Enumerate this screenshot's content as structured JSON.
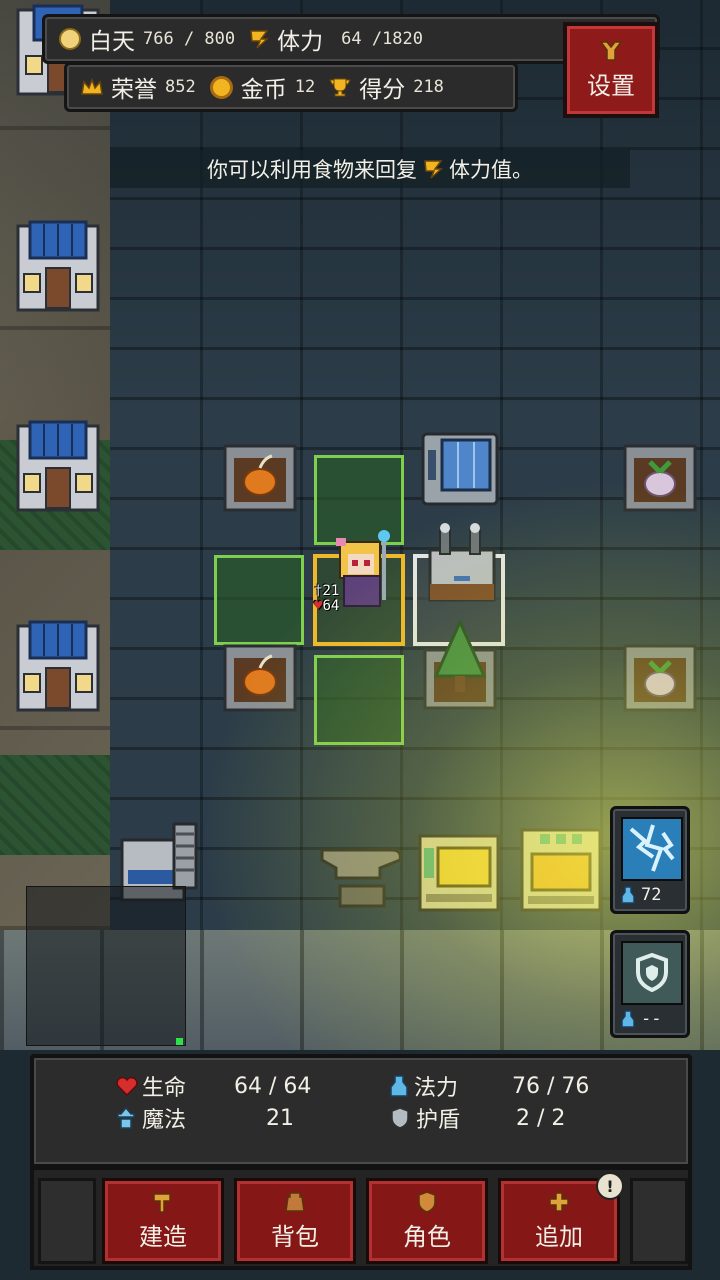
{
  "hud": {
    "day_label": "白天",
    "day_value": "766 / 800",
    "stamina_label": "体力",
    "stamina_value": "64 /1820",
    "honor_label": "荣誉",
    "honor_value": "852",
    "gold_label": "金币",
    "gold_value": "12",
    "score_label": "得分",
    "score_value": "218"
  },
  "settings": {
    "label": "设置"
  },
  "hint": {
    "before": "你可以利用食物来回复",
    "after": "体力值。"
  },
  "player": {
    "attack": "21",
    "hp": "64"
  },
  "skills": [
    {
      "name": "lightning",
      "cost": "72"
    },
    {
      "name": "shield",
      "cost": "--"
    }
  ],
  "stats": {
    "hp_label": "生命",
    "hp_value": "64 / 64",
    "mp_label": "法力",
    "mp_value": "76 / 76",
    "magic_label": "魔法",
    "magic_value": "21",
    "shield_label": "护盾",
    "shield_value": "2 / 2"
  },
  "menu": {
    "build": "建造",
    "bag": "背包",
    "character": "角色",
    "add": "追加",
    "add_badge": "!"
  },
  "colors": {
    "accent_red": "#851717",
    "highlight_green": "#7fcf4f",
    "highlight_gold": "#f0b72a",
    "heart": "#d62d2d",
    "mana": "#5fb7e8"
  }
}
